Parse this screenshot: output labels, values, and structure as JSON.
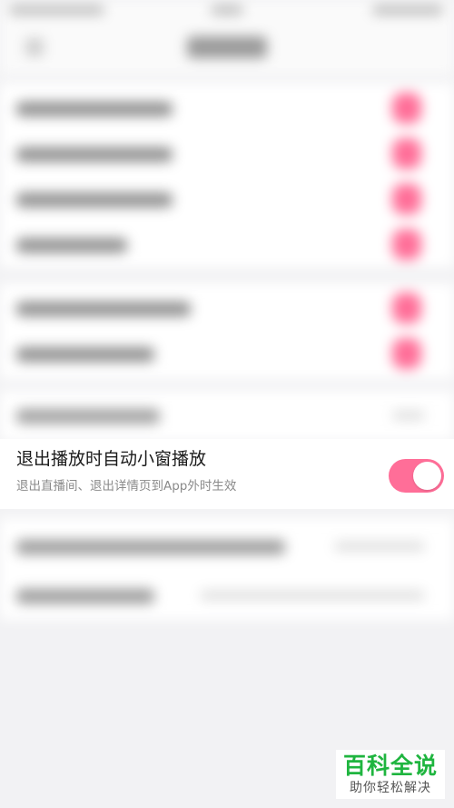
{
  "focused_setting": {
    "title": "退出播放时自动小窗播放",
    "subtitle": "退出直播间、退出详情页到App外时生效",
    "toggle_state": "on"
  },
  "watermark": {
    "title": "百科全说",
    "subtitle": "助你轻松解决"
  },
  "colors": {
    "accent": "#ff6e98",
    "background": "#f2f2f4",
    "watermark_green": "#1fb53f"
  }
}
